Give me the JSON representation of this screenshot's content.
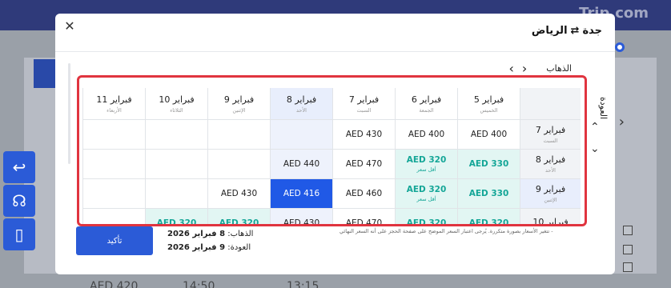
{
  "modal": {
    "route": {
      "from": "جدة",
      "to": "الرياض"
    },
    "departure_label": "الذهاب",
    "return_label": "العودة",
    "note": "- تتغير الأسعار بصورة متكررة. يُرجى اعتبار السعر الموضح على صفحة الحجز على أنه السعر النهائي",
    "summary": {
      "departure_label": "الذهاب:",
      "departure_value": "8 فبراير 2026",
      "return_label": "العودة:",
      "return_value": "9 فبراير 2026"
    },
    "confirm_label": "تأكيد",
    "columns": [
      {
        "date": "5 فبراير",
        "weekday": "الخميس"
      },
      {
        "date": "6 فبراير",
        "weekday": "الجمعة"
      },
      {
        "date": "7 فبراير",
        "weekday": "السبت"
      },
      {
        "date": "8 فبراير",
        "weekday": "الأحد",
        "selected": true
      },
      {
        "date": "9 فبراير",
        "weekday": "الإثنين"
      },
      {
        "date": "10 فبراير",
        "weekday": "الثلاثاء"
      },
      {
        "date": "11 فبراير",
        "weekday": "الأربعاء"
      }
    ],
    "rows": [
      {
        "date": "7 فبراير",
        "weekday": "السبت",
        "cells": [
          {
            "price": "AED 400"
          },
          {
            "price": "AED 400"
          },
          {
            "price": "AED 430"
          },
          {
            "price": ""
          },
          {
            "price": ""
          },
          {
            "price": ""
          },
          {
            "price": ""
          }
        ]
      },
      {
        "date": "8 فبراير",
        "weekday": "الأحد",
        "cells": [
          {
            "price": "AED 330",
            "low": true
          },
          {
            "price": "AED 320",
            "low": true,
            "tag": "أقل سعر"
          },
          {
            "price": "AED 470"
          },
          {
            "price": "AED 440"
          },
          {
            "price": ""
          },
          {
            "price": ""
          },
          {
            "price": ""
          }
        ]
      },
      {
        "date": "9 فبراير",
        "weekday": "الإثنين",
        "selected": true,
        "cells": [
          {
            "price": "AED 330",
            "low": true
          },
          {
            "price": "AED 320",
            "low": true,
            "tag": "أقل سعر"
          },
          {
            "price": "AED 460"
          },
          {
            "price": "AED 416",
            "chosen": true
          },
          {
            "price": "AED 430"
          },
          {
            "price": ""
          },
          {
            "price": ""
          }
        ]
      },
      {
        "date": "10 فبراير",
        "weekday": "",
        "cells": [
          {
            "price": "AED 320",
            "low": true
          },
          {
            "price": "AED 320",
            "low": true
          },
          {
            "price": "AED 470"
          },
          {
            "price": "AED 430"
          },
          {
            "price": "AED 320",
            "low": true
          },
          {
            "price": "AED 320",
            "low": true
          },
          {
            "price": ""
          }
        ]
      }
    ]
  },
  "background": {
    "logo": "Trip.com",
    "bottom_price": "AED 420",
    "bottom_time_1": "14:50",
    "bottom_time_2": "13:15"
  }
}
